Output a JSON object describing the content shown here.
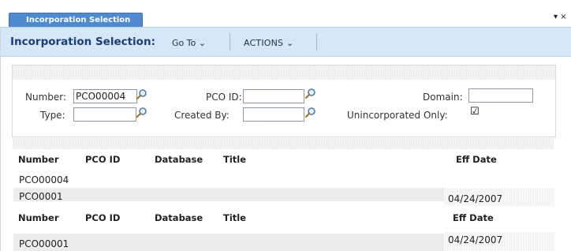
{
  "tab": {
    "label": "Incorporation Selection",
    "close_glyph": "▾ ×"
  },
  "toolbar": {
    "title": "Incorporation Selection:",
    "goto_label": "Go To ⌄",
    "actions_label": "ACTIONS ⌄"
  },
  "form": {
    "number_label": "Number:",
    "number_value": "PCO00004",
    "pco_id_label": "PCO ID:",
    "pco_id_value": "",
    "domain_label": "Domain:",
    "domain_value": "",
    "type_label": "Type:",
    "type_value": "",
    "created_by_label": "Created By:",
    "created_by_value": "",
    "unincorporated_label": "Unincorporated Only:",
    "unincorporated_checked": "☑"
  },
  "list1": {
    "headers": {
      "number": "Number",
      "pco_id": "PCO ID",
      "database": "Database",
      "title": "Title",
      "eff_date": "Eff Date"
    },
    "rows": [
      {
        "number": "PCO00004",
        "eff_date": ""
      },
      {
        "number": "PCO0001",
        "eff_date": "04/24/2007"
      }
    ]
  },
  "list2": {
    "headers": {
      "number": "Number",
      "pco_id": "PCO ID",
      "database": "Database",
      "title": "Title",
      "eff_date": "Eff Date"
    },
    "rows": [
      {
        "number": "PCO00001",
        "eff_date": "04/24/2007"
      }
    ]
  }
}
